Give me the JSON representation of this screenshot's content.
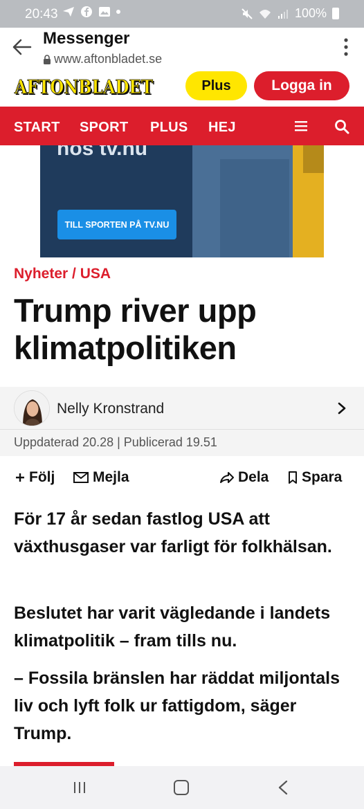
{
  "status_bar": {
    "time": "20:43",
    "battery": "100%"
  },
  "browser": {
    "title": "Messenger",
    "url": "www.aftonbladet.se"
  },
  "header": {
    "logo_text": "AFTONBLADET",
    "plus_label": "Plus",
    "login_label": "Logga in"
  },
  "nav": {
    "items": [
      "START",
      "SPORT",
      "PLUS",
      "HEJ"
    ]
  },
  "ad": {
    "headline": "hos tv.nu",
    "button_label": "TILL SPORTEN PÅ TV.NU"
  },
  "article": {
    "section": "Nyheter / USA",
    "headline": "Trump river upp klimatpolitiken",
    "author": "Nelly Kronstrand",
    "timestamps": "Uppdaterad 20.28 | Publicerad 19.51",
    "actions": {
      "follow": "Följ",
      "mail": "Mejla",
      "share": "Dela",
      "save": "Spara"
    },
    "lead": [
      "För 17 år sedan fastlog USA att växthusgaser var farligt för folkhälsan.",
      "Beslutet har varit vägledande i landets klimatpolitik – fram tills nu.",
      "– Fossila bränslen har räddat miljontals liv och lyft folk ur fattigdom, säger Trump."
    ]
  },
  "colors": {
    "brand_red": "#dc1e2c",
    "plus_yellow": "#ffe600",
    "ad_button_blue": "#1a8fe6"
  },
  "icons": [
    "send-icon",
    "facebook-icon",
    "gallery-icon",
    "mute-icon",
    "wifi-icon",
    "signal-icon",
    "battery-icon",
    "back-arrow-icon",
    "lock-icon",
    "kebab-menu-icon",
    "hamburger-menu-icon",
    "search-icon",
    "plus-icon",
    "mail-icon",
    "share-icon",
    "bookmark-icon",
    "chevron-right-icon",
    "recents-icon",
    "home-icon",
    "nav-back-icon"
  ]
}
